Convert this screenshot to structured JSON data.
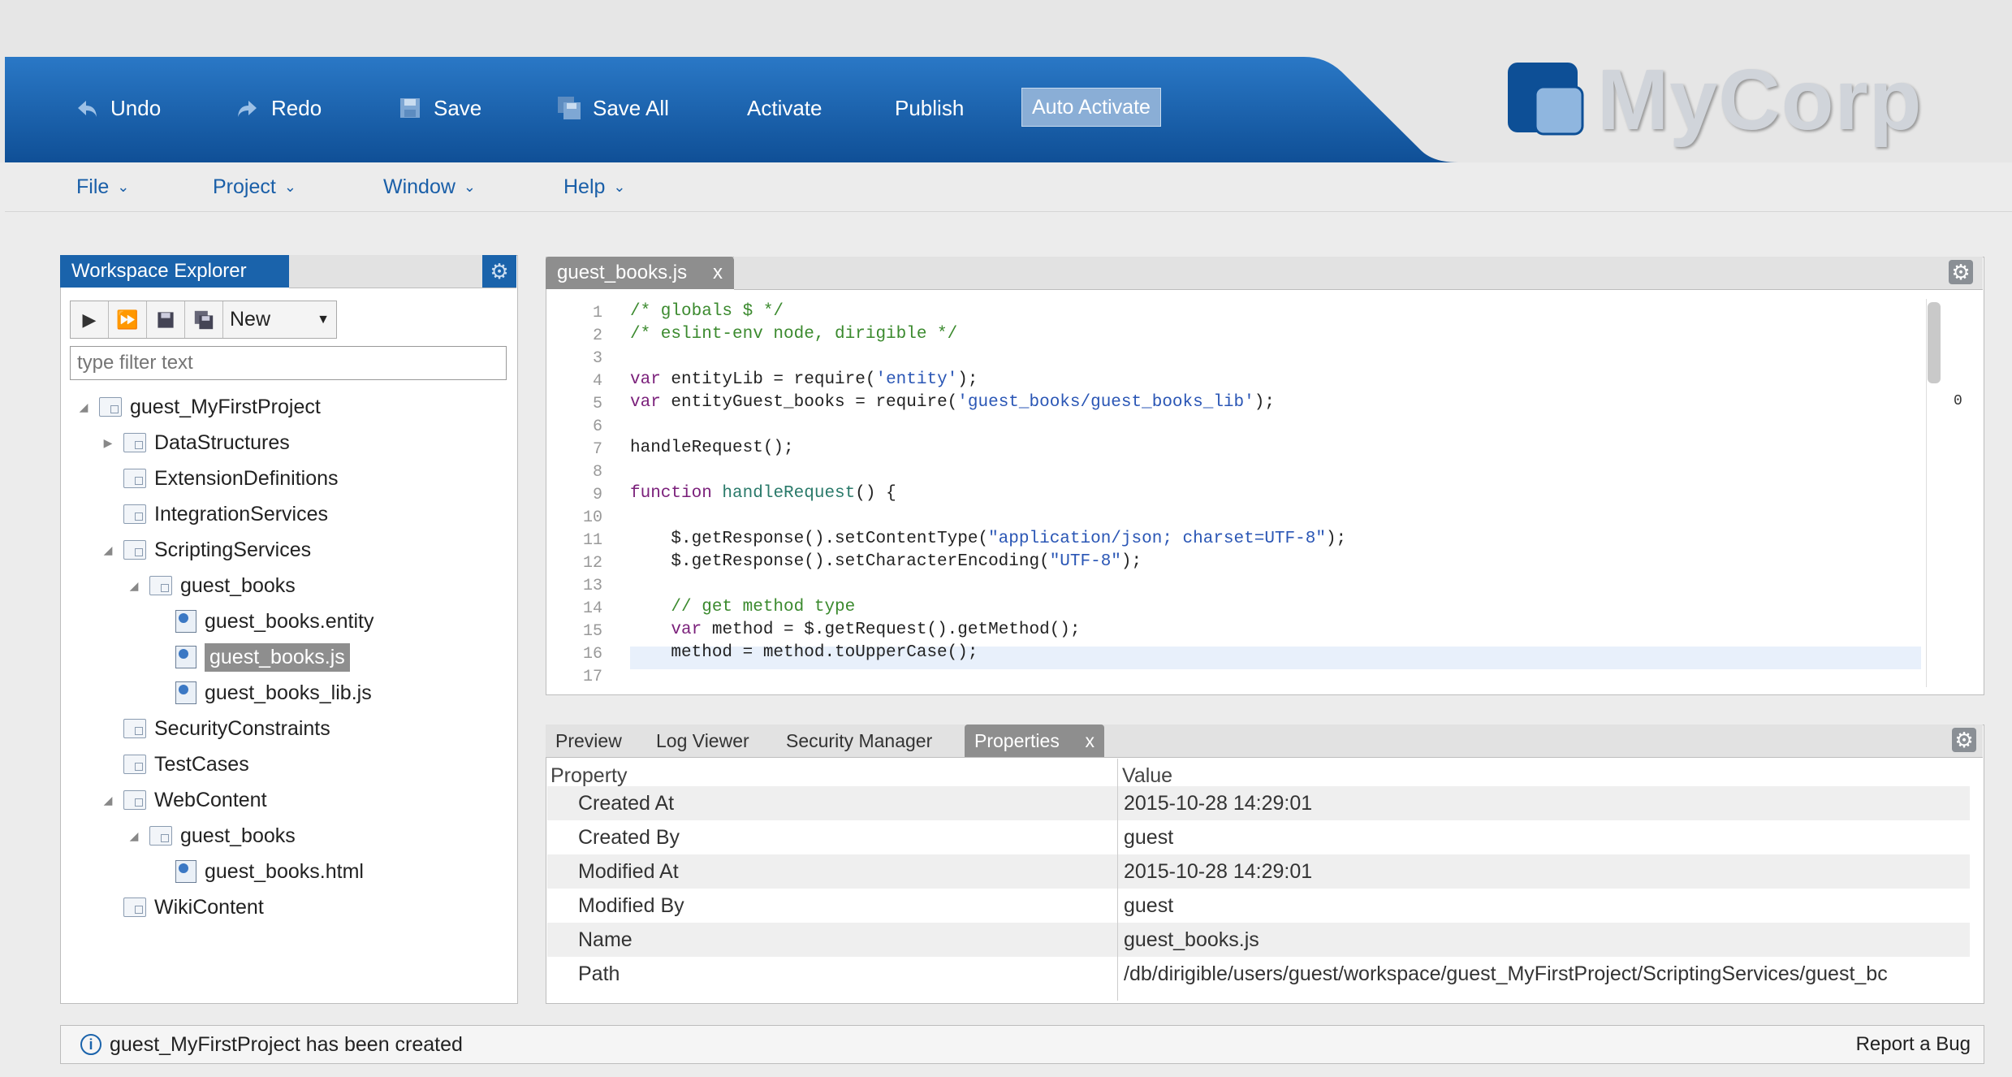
{
  "toolbar": {
    "undo": "Undo",
    "redo": "Redo",
    "save": "Save",
    "save_all": "Save All",
    "activate": "Activate",
    "publish": "Publish",
    "auto_activate": "Auto Activate"
  },
  "brand": {
    "logo_text": "MyCorp",
    "color": "#1a63ab"
  },
  "menu": {
    "file": "File",
    "project": "Project",
    "window": "Window",
    "help": "Help"
  },
  "explorer": {
    "title": "Workspace Explorer",
    "new_label": "New",
    "filter_placeholder": "type filter text",
    "tree": [
      {
        "label": "guest_MyFirstProject"
      },
      {
        "label": "DataStructures"
      },
      {
        "label": "ExtensionDefinitions"
      },
      {
        "label": "IntegrationServices"
      },
      {
        "label": "ScriptingServices"
      },
      {
        "label": "guest_books"
      },
      {
        "label": "guest_books.entity"
      },
      {
        "label": "guest_books.js"
      },
      {
        "label": "guest_books_lib.js"
      },
      {
        "label": "SecurityConstraints"
      },
      {
        "label": "TestCases"
      },
      {
        "label": "WebContent"
      },
      {
        "label": "guest_books"
      },
      {
        "label": "guest_books.html"
      },
      {
        "label": "WikiContent"
      }
    ]
  },
  "editor": {
    "tab_label": "guest_books.js",
    "tab_close": "x",
    "overview_mark": "0",
    "line_numbers": [
      "1",
      "2",
      "3",
      "4",
      "5",
      "6",
      "7",
      "8",
      "9",
      "10",
      "11",
      "12",
      "13",
      "14",
      "15",
      "16",
      "17"
    ],
    "code": {
      "l1": "/* globals $ */",
      "l2": "/* eslint-env node, dirigible */",
      "l4_kw": "var",
      "l4_a": " entityLib = require(",
      "l4_s": "'entity'",
      "l4_b": ");",
      "l5_kw": "var",
      "l5_a": " entityGuest_books = require(",
      "l5_s": "'guest_books/guest_books_lib'",
      "l5_b": ");",
      "l7": "handleRequest();",
      "l9_kw": "function",
      "l9_fn": " handleRequest",
      "l9_b": "() {",
      "l11_a": "    $.getResponse().setContentType(",
      "l11_s": "\"application/json; charset=UTF-8\"",
      "l11_b": ");",
      "l12_a": "    $.getResponse().setCharacterEncoding(",
      "l12_s": "\"UTF-8\"",
      "l12_b": ");",
      "l14": "    // get method type",
      "l15_pre": "    ",
      "l15_kw": "var",
      "l15_a": " method = $.getRequest().getMethod();",
      "l16": "    method = method.toUpperCase();"
    }
  },
  "bottom": {
    "tabs": {
      "preview": "Preview",
      "log_viewer": "Log Viewer",
      "security_manager": "Security Manager",
      "properties": "Properties",
      "close": "x"
    },
    "headers": {
      "property": "Property",
      "value": "Value"
    },
    "rows": [
      {
        "property": "Created At",
        "value": "2015-10-28 14:29:01"
      },
      {
        "property": "Created By",
        "value": "guest"
      },
      {
        "property": "Modified At",
        "value": "2015-10-28 14:29:01"
      },
      {
        "property": "Modified By",
        "value": "guest"
      },
      {
        "property": "Name",
        "value": "guest_books.js"
      },
      {
        "property": "Path",
        "value": "/db/dirigible/users/guest/workspace/guest_MyFirstProject/ScriptingServices/guest_bc"
      }
    ]
  },
  "status": {
    "message": "guest_MyFirstProject has been created",
    "report_bug": "Report a Bug"
  }
}
